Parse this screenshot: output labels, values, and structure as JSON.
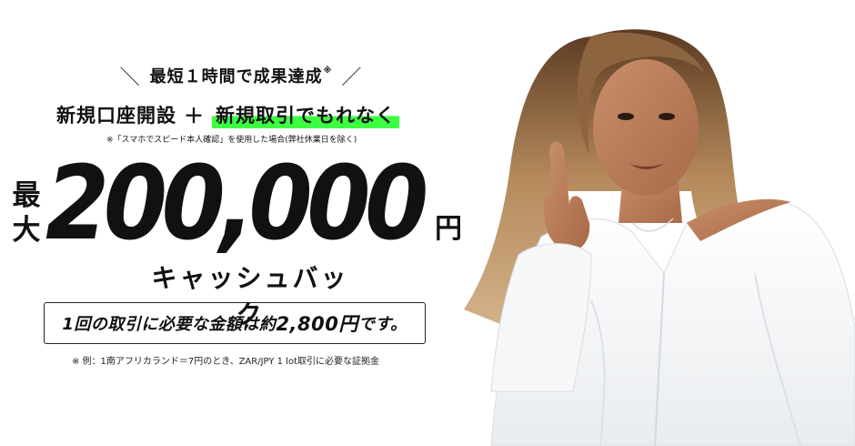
{
  "headline": {
    "text": "最短１時間で成果達成",
    "mark": "※"
  },
  "offer_line": {
    "left_text": "新規口座開設",
    "plus": "＋",
    "highlight_text": "新規取引でもれなく"
  },
  "note_top": "※「スマホでスピード本人確認」を使用した場合(弊社休業日を除く)",
  "max_label_top": "最",
  "max_label_bottom": "大",
  "amount": "200,000",
  "amount_unit": "円",
  "cashback": "キャッシュバック",
  "info_box": {
    "prefix": "1回の取引に必要な金額は約",
    "amount": "2,800円",
    "suffix": "です。"
  },
  "note_bottom": "※ 例：1南アフリカランド＝7円のとき、ZAR/JPY 1 lot取引に必要な証拠金",
  "colors": {
    "highlight": "#3cff41",
    "text": "#111111",
    "background": "#ffffff"
  }
}
